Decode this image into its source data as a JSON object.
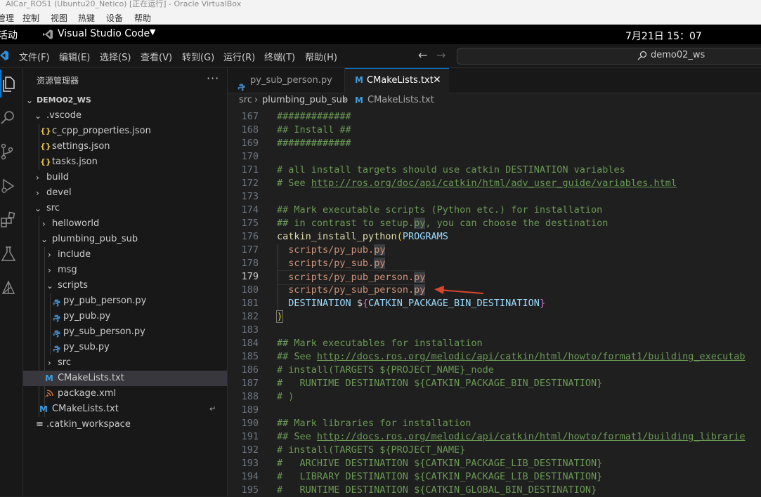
{
  "window": {
    "title": "AICar_ROS1 (Ubuntu20_Netico) [正在运行] - Oracle VirtualBox",
    "vbox_menu": [
      "管理",
      "控制",
      "视图",
      "热键",
      "设备",
      "帮助"
    ]
  },
  "gnome": {
    "activities": "活动",
    "app_name": "Visual Studio Code",
    "clock": "7月21日  15：07"
  },
  "menubar": {
    "items": [
      "文件(F)",
      "编辑(E)",
      "选择(S)",
      "查看(V)",
      "转到(G)",
      "运行(R)",
      "终端(T)",
      "帮助(H)"
    ],
    "search_text": "demo02_ws"
  },
  "explorer": {
    "title": "资源管理器",
    "root": "DEMO02_WS",
    "items": [
      {
        "label": ".vscode",
        "kind": "folder-open"
      },
      {
        "label": "c_cpp_properties.json",
        "kind": "json",
        "icon": "{}"
      },
      {
        "label": "settings.json",
        "kind": "json",
        "icon": "{}"
      },
      {
        "label": "tasks.json",
        "kind": "json",
        "icon": "{}"
      },
      {
        "label": "build",
        "kind": "folder"
      },
      {
        "label": "devel",
        "kind": "folder"
      },
      {
        "label": "src",
        "kind": "folder-open"
      },
      {
        "label": "helloworld",
        "kind": "folder"
      },
      {
        "label": "plumbing_pub_sub",
        "kind": "folder-open"
      },
      {
        "label": "include",
        "kind": "folder"
      },
      {
        "label": "msg",
        "kind": "folder"
      },
      {
        "label": "scripts",
        "kind": "folder-open"
      },
      {
        "label": "py_pub_person.py",
        "kind": "python"
      },
      {
        "label": "py_pub.py",
        "kind": "python"
      },
      {
        "label": "py_sub_person.py",
        "kind": "python"
      },
      {
        "label": "py_sub.py",
        "kind": "python"
      },
      {
        "label": "src",
        "kind": "folder"
      },
      {
        "label": "CMakeLists.txt",
        "kind": "cmake",
        "icon": "M",
        "selected": true
      },
      {
        "label": "package.xml",
        "kind": "xml"
      },
      {
        "label": "CMakeLists.txt",
        "kind": "cmake",
        "icon": "M"
      },
      {
        "label": ".catkin_workspace",
        "kind": "text",
        "icon": "≡"
      }
    ]
  },
  "tabs": [
    {
      "label": "py_sub_person.py",
      "active": false
    },
    {
      "label": "CMakeLists.txt",
      "active": true
    }
  ],
  "breadcrumb": [
    "src",
    "plumbing_pub_sub",
    "CMakeLists.txt"
  ],
  "code": {
    "lines": [
      {
        "num": "167",
        "text": "#############"
      },
      {
        "num": "168",
        "text": "## Install ##"
      },
      {
        "num": "169",
        "text": "#############"
      },
      {
        "num": "170",
        "text": ""
      },
      {
        "num": "171",
        "text": "# all install targets should use catkin DESTINATION variables"
      },
      {
        "num": "172",
        "text": "# See http://ros.org/doc/api/catkin/html/adv_user_guide/variables.html"
      },
      {
        "num": "173",
        "text": ""
      },
      {
        "num": "174",
        "text": "## Mark executable scripts (Python etc.) for installation"
      },
      {
        "num": "175",
        "text": "## in contrast to setup.py, you can choose the destination"
      },
      {
        "num": "176",
        "text": "catkin_install_python(PROGRAMS"
      },
      {
        "num": "177",
        "text": "  scripts/py_pub.py"
      },
      {
        "num": "178",
        "text": "  scripts/py_sub.py"
      },
      {
        "num": "179",
        "text": "  scripts/py_pub_person.py"
      },
      {
        "num": "180",
        "text": "  scripts/py_sub_person.py"
      },
      {
        "num": "181",
        "text": "  DESTINATION ${CATKIN_PACKAGE_BIN_DESTINATION}"
      },
      {
        "num": "182",
        "text": ")"
      },
      {
        "num": "183",
        "text": ""
      },
      {
        "num": "184",
        "text": "## Mark executables for installation"
      },
      {
        "num": "185",
        "text": "## See http://docs.ros.org/melodic/api/catkin/html/howto/format1/building_executab"
      },
      {
        "num": "186",
        "text": "# install(TARGETS ${PROJECT_NAME}_node"
      },
      {
        "num": "187",
        "text": "#   RUNTIME DESTINATION ${CATKIN_PACKAGE_BIN_DESTINATION}"
      },
      {
        "num": "188",
        "text": "# )"
      },
      {
        "num": "189",
        "text": ""
      },
      {
        "num": "190",
        "text": "## Mark libraries for installation"
      },
      {
        "num": "191",
        "text": "## See http://docs.ros.org/melodic/api/catkin/html/howto/format1/building_librarie"
      },
      {
        "num": "192",
        "text": "# install(TARGETS ${PROJECT_NAME}"
      },
      {
        "num": "193",
        "text": "#   ARCHIVE DESTINATION ${CATKIN_PACKAGE_LIB_DESTINATION}"
      },
      {
        "num": "194",
        "text": "#   LIBRARY DESTINATION ${CATKIN_PACKAGE_LIB_DESTINATION}"
      },
      {
        "num": "195",
        "text": "#   RUNTIME DESTINATION ${CATKIN_GLOBAL_BIN_DESTINATION}"
      }
    ],
    "current_line": "179"
  },
  "colors": {
    "accent": "#0078d4",
    "comment": "#6a9955",
    "string": "#ce9178",
    "function": "#dcdcaa",
    "variable": "#9cdcfe",
    "annotation_arrow": "#d9472b"
  },
  "icons": [
    "explorer-icon",
    "search-icon",
    "source-control-icon",
    "run-debug-icon",
    "extensions-icon",
    "testing-icon",
    "ros-icon"
  ]
}
